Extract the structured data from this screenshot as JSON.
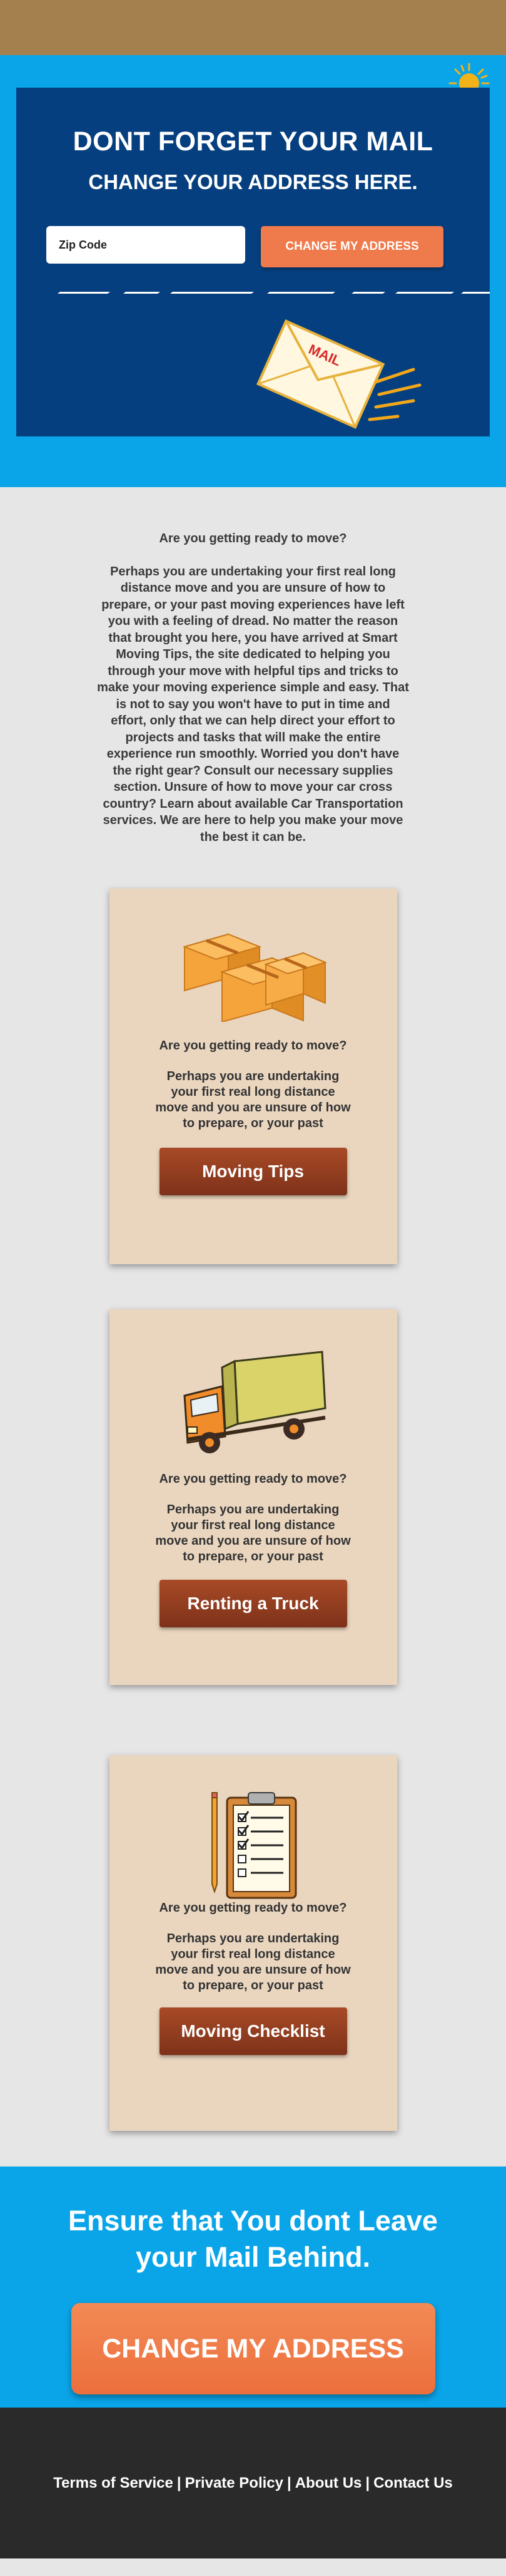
{
  "hero": {
    "title": "DONT FORGET YOUR MAIL",
    "subtitle": "CHANGE YOUR ADDRESS HERE.",
    "zip_placeholder": "Zip Code",
    "button_label": "CHANGE MY ADDRESS",
    "envelope_text": "MAIL"
  },
  "intro": {
    "heading": "Are you getting ready to move?",
    "body": "Perhaps you are undertaking your first real long distance move and you are unsure of how to prepare, or your past moving experiences have left you with a feeling of dread.  No matter the reason that brought you here, you have arrived at Smart Moving Tips, the site dedicated to helping you through your move with helpful tips and tricks to make your moving experience simple and easy.  That is not to say you won't have to put in time and effort, only that we can help direct your effort to projects and tasks that will make the entire experience run smoothly.  Worried you don't have the right gear? Consult our necessary supplies section.  Unsure of how to move your car cross country?  Learn about available Car Transportation services.  We are here to help you make your move the best it can be."
  },
  "cards": [
    {
      "heading": "Are you getting ready to move?",
      "body": "Perhaps you are undertaking your first real long distance move and you are unsure of how to prepare, or your past",
      "button": "Moving Tips",
      "icon": "boxes-icon"
    },
    {
      "heading": "Are you getting ready to move?",
      "body": "Perhaps you are undertaking your first real long distance move and you are unsure of how to prepare, or your past",
      "button": "Renting a Truck",
      "icon": "truck-icon"
    },
    {
      "heading": "Are you getting ready to move?",
      "body": "Perhaps you are undertaking your first real long distance move and you are unsure of how to prepare, or your past",
      "button": "Moving Checklist",
      "icon": "checklist-icon"
    }
  ],
  "cta": {
    "heading": "Ensure that You dont Leave your Mail Behind.",
    "button": "CHANGE MY ADDRESS"
  },
  "footer": {
    "links": [
      "Terms of Service",
      "Private Policy",
      "About Us",
      "Contact Us"
    ],
    "separator": "|"
  },
  "colors": {
    "top_bar": "#a5804f",
    "hero_bg": "#0aa5e8",
    "hero_box": "#053f7f",
    "accent_orange": "#ef7a4b",
    "card_bg": "#ead6bf",
    "card_button": "#8c3a1f",
    "footer_bg": "#2a2a2a"
  }
}
